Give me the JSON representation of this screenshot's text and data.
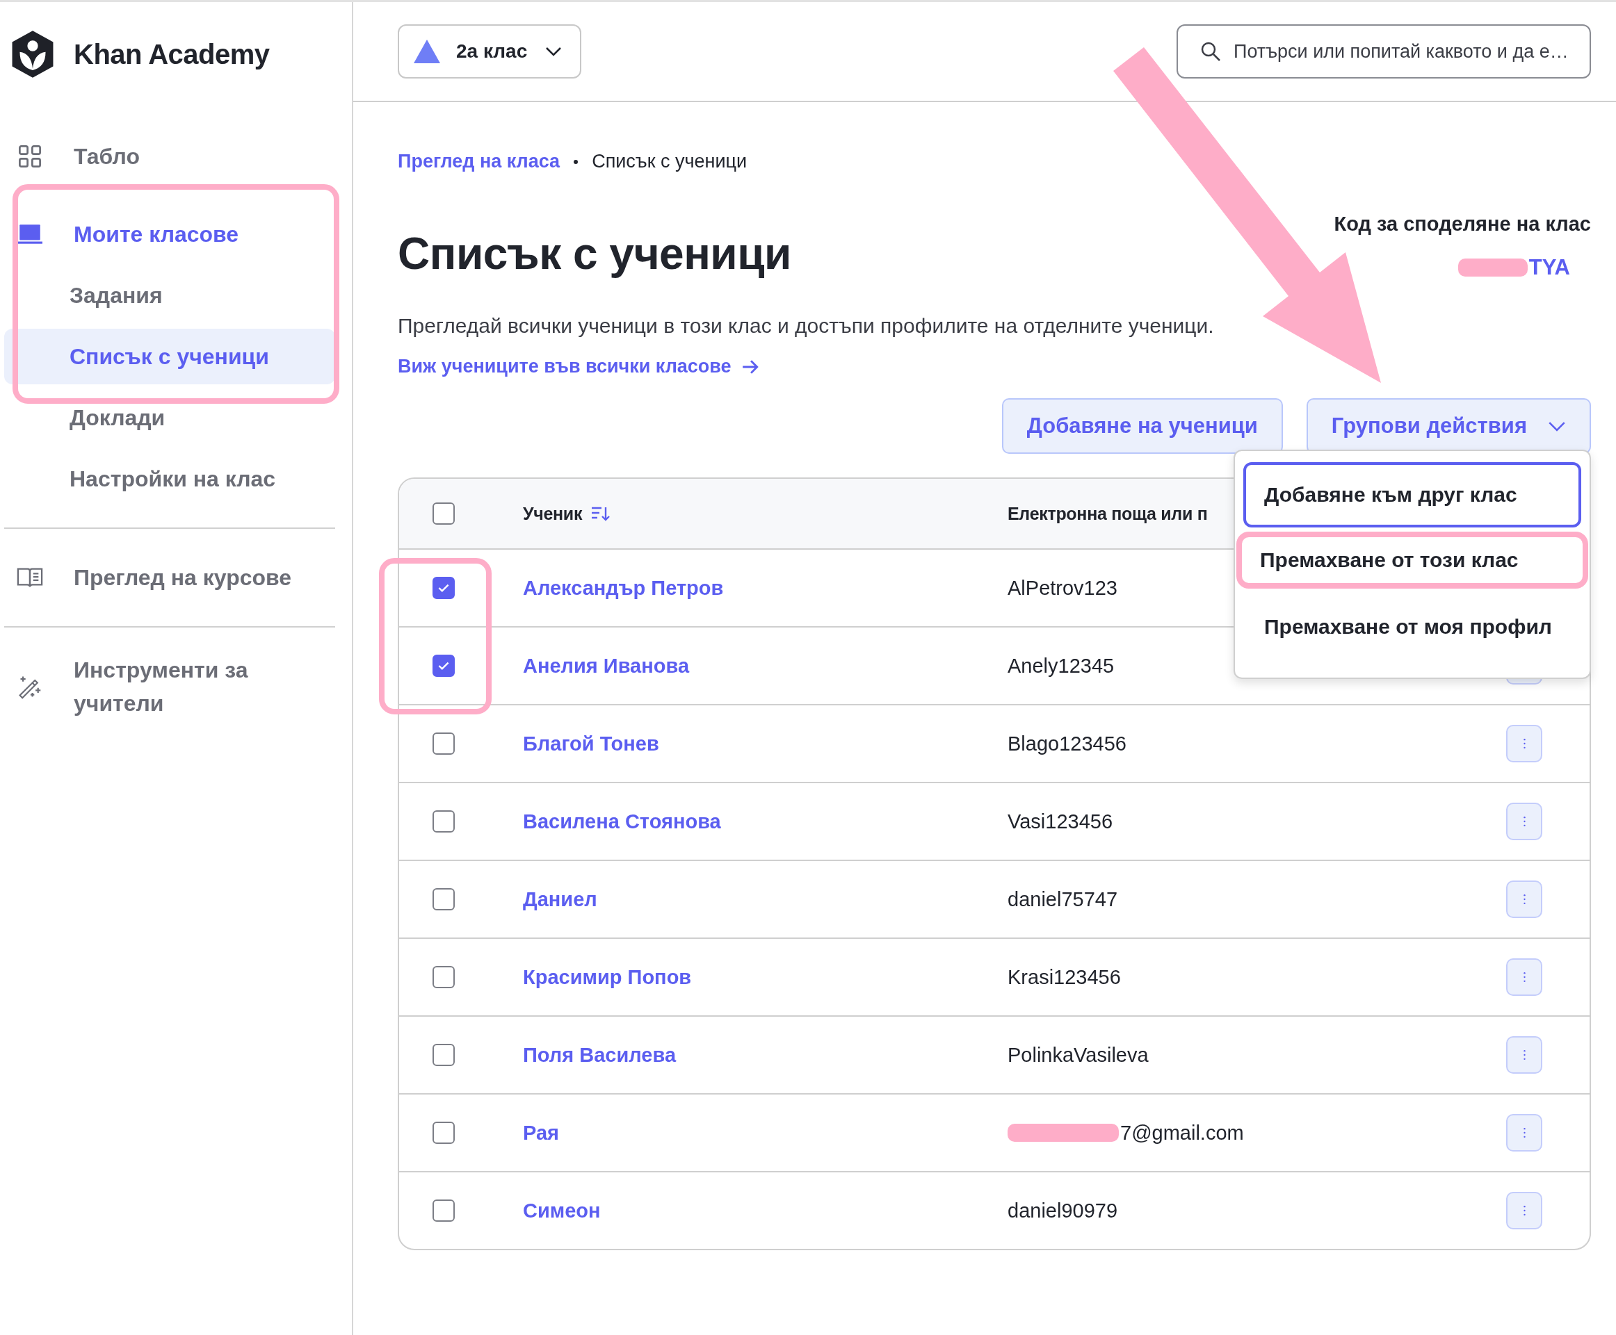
{
  "brand": {
    "name": "Khan Academy"
  },
  "sidebar": {
    "items": [
      {
        "label": "Табло",
        "selected": false
      },
      {
        "label": "Моите класове",
        "selected": true,
        "children": [
          {
            "label": "Задания",
            "selected": false
          },
          {
            "label": "Списък с ученици",
            "selected": true
          },
          {
            "label": "Доклади",
            "selected": false
          },
          {
            "label": "Настройки на клас",
            "selected": false
          }
        ]
      },
      {
        "label": "Преглед на курсове",
        "selected": false
      },
      {
        "label": "Инструменти за учители",
        "selected": false
      }
    ]
  },
  "class_picker": {
    "label": "2а клас"
  },
  "search": {
    "placeholder": "Потърси или попитай каквото и да е…"
  },
  "breadcrumb": [
    {
      "label": "Преглед на класа",
      "link": true
    },
    {
      "label": "Списък с ученици",
      "link": false
    }
  ],
  "title": "Списък с ученици",
  "description": "Прегледай всички ученици в този клас и достъпи профилите на отделните ученици.",
  "all_classes_link": "Виж учениците във всички класове",
  "class_code": {
    "label": "Код за споделяне на клас",
    "code": "TYA",
    "redacted": true
  },
  "add_button": "Добавяне на ученици",
  "bulk_actions": {
    "label": "Групови действия",
    "expanded": true,
    "menu": [
      {
        "label": "Добавяне към друг клас",
        "focused": true,
        "highlighted": false
      },
      {
        "label": "Премахване от този клас",
        "focused": false,
        "highlighted": true
      },
      {
        "label": "Премахване от моя профил",
        "focused": false,
        "highlighted": false
      }
    ]
  },
  "table": {
    "all_selected": false,
    "columns": [
      "Ученик",
      "Електронна поща или п"
    ],
    "rows": [
      {
        "name": "Александър Петров",
        "login": "AlPetrov123",
        "selected": true,
        "redacted": false,
        "actions": false
      },
      {
        "name": "Анелия Иванова",
        "login": "Anely12345",
        "selected": true,
        "redacted": false,
        "actions": true
      },
      {
        "name": "Благой Тонев",
        "login": "Blago123456",
        "selected": false,
        "redacted": false,
        "actions": true
      },
      {
        "name": "Василена Стоянова",
        "login": "Vasi123456",
        "selected": false,
        "redacted": false,
        "actions": true
      },
      {
        "name": "Даниел",
        "login": "daniel75747",
        "selected": false,
        "redacted": false,
        "actions": true
      },
      {
        "name": "Красимир Попов",
        "login": "Krasi123456",
        "selected": false,
        "redacted": false,
        "actions": true
      },
      {
        "name": "Поля Василева",
        "login": "PolinkaVasileva",
        "selected": false,
        "redacted": false,
        "actions": true
      },
      {
        "name": "Рая",
        "login": "7@gmail.com",
        "selected": false,
        "redacted": true,
        "actions": true
      },
      {
        "name": "Симеон",
        "login": "daniel90979",
        "selected": false,
        "redacted": false,
        "actions": true
      }
    ]
  }
}
